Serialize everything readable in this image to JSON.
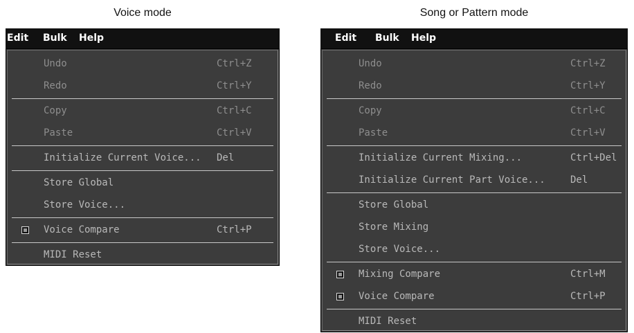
{
  "captions": {
    "left": "Voice mode",
    "right": "Song or Pattern mode"
  },
  "menubar": {
    "items": [
      "Edit",
      "Bulk",
      "Help"
    ]
  },
  "voice_menu": {
    "items": [
      {
        "label": "Undo",
        "shortcut": "Ctrl+Z",
        "enabled": false
      },
      {
        "label": "Redo",
        "shortcut": "Ctrl+Y",
        "enabled": false
      },
      {
        "label": "Copy",
        "shortcut": "Ctrl+C",
        "enabled": false
      },
      {
        "label": "Paste",
        "shortcut": "Ctrl+V",
        "enabled": false
      },
      {
        "label": "Initialize Current Voice...",
        "shortcut": "Del",
        "enabled": true
      },
      {
        "label": "Store Global",
        "shortcut": "",
        "enabled": true
      },
      {
        "label": "Store Voice...",
        "shortcut": "",
        "enabled": true
      },
      {
        "label": "Voice Compare",
        "shortcut": "Ctrl+P",
        "enabled": true,
        "checkbox": true
      },
      {
        "label": "MIDI Reset",
        "shortcut": "",
        "enabled": true
      }
    ]
  },
  "song_menu": {
    "items": [
      {
        "label": "Undo",
        "shortcut": "Ctrl+Z",
        "enabled": false
      },
      {
        "label": "Redo",
        "shortcut": "Ctrl+Y",
        "enabled": false
      },
      {
        "label": "Copy",
        "shortcut": "Ctrl+C",
        "enabled": false
      },
      {
        "label": "Paste",
        "shortcut": "Ctrl+V",
        "enabled": false
      },
      {
        "label": "Initialize Current Mixing...",
        "shortcut": "Ctrl+Del",
        "enabled": true
      },
      {
        "label": "Initialize Current Part Voice...",
        "shortcut": "Del",
        "enabled": true
      },
      {
        "label": "Store Global",
        "shortcut": "",
        "enabled": true
      },
      {
        "label": "Store Mixing",
        "shortcut": "",
        "enabled": true
      },
      {
        "label": "Store Voice...",
        "shortcut": "",
        "enabled": true
      },
      {
        "label": "Mixing Compare",
        "shortcut": "Ctrl+M",
        "enabled": true,
        "checkbox": true
      },
      {
        "label": "Voice Compare",
        "shortcut": "Ctrl+P",
        "enabled": true,
        "checkbox": true
      },
      {
        "label": "MIDI Reset",
        "shortcut": "",
        "enabled": true
      }
    ]
  }
}
